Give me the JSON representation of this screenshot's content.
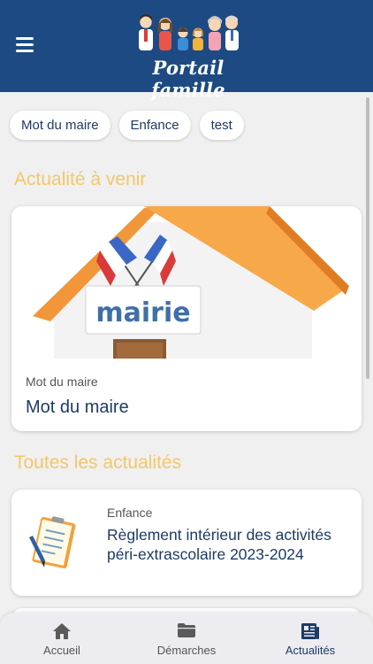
{
  "header": {
    "app_title": "Portail famille",
    "menu_icon": "hamburger-menu-icon",
    "background_color": "#1d4a82"
  },
  "chips": [
    {
      "label": "Mot du maire"
    },
    {
      "label": "Enfance"
    },
    {
      "label": "test"
    }
  ],
  "upcoming": {
    "section_title": "Actualité à venir",
    "card": {
      "image_text": "mairie",
      "category": "Mot du maire",
      "title": "Mot du maire"
    }
  },
  "all_news": {
    "section_title": "Toutes les actualités",
    "items": [
      {
        "icon": "document-checklist-icon",
        "category": "Enfance",
        "title": "Règlement intérieur des activités péri-extrascolaire 2023-2024"
      }
    ]
  },
  "tabbar": {
    "tabs": [
      {
        "label": "Accueil",
        "icon": "home-icon",
        "active": false
      },
      {
        "label": "Démarches",
        "icon": "folder-icon",
        "active": false
      },
      {
        "label": "Actualités",
        "icon": "newspaper-icon",
        "active": true
      }
    ]
  },
  "colors": {
    "accent_yellow": "#f2c768",
    "title_blue": "#1d3b66",
    "roof_orange": "#f2963a"
  }
}
